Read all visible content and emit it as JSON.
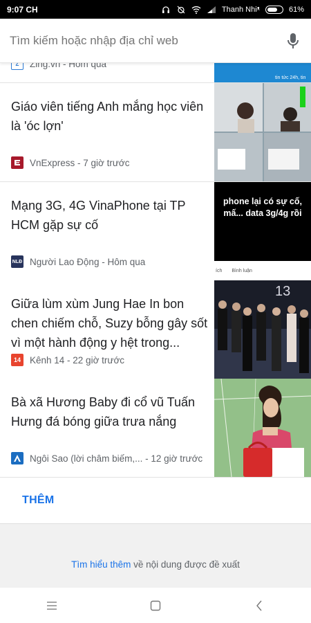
{
  "status_bar": {
    "time": "9:07 CH",
    "carrier": "Thanh Nhiᵜ",
    "battery": "61%",
    "icons": [
      "headphones-icon",
      "alarm-off-icon",
      "wifi-icon",
      "signal-icon",
      "battery-icon"
    ]
  },
  "search": {
    "placeholder": "Tìm kiếm hoặc nhập địa chỉ web",
    "icon": "mic-icon"
  },
  "feed": {
    "partial_card": {
      "source": "Zing.vn - Hôm qua",
      "thumb_text": "tin tức 24h, tin"
    },
    "cards": [
      {
        "title": "Giáo viên tiếng Anh mắng học viên là 'óc lợn'",
        "source": "VnExpress - 7 giờ trước",
        "logo_color": "#a7192b"
      },
      {
        "title": "Mạng 3G, 4G VinaPhone tại TP HCM gặp sự cố",
        "source": "Người Lao Động - Hôm qua",
        "logo_color": "#28345c",
        "logo_text": "NLĐ",
        "thumb_text": "phone lại có sự cố, mấ... data 3g/4g rồi",
        "thumb_footer": [
          "ích",
          "Bình luận"
        ]
      },
      {
        "title": "Giữa lùm xùm Jung Hae In bon chen chiếm chỗ, Suzy bỗng gây sốt vì một hành động y hệt trong...",
        "source": "Kênh 14 - 22 giờ trước",
        "logo_color": "#e8442e",
        "logo_text": "14"
      },
      {
        "title": "Bà xã Hương Baby đi cổ vũ Tuấn Hưng đá bóng giữa trưa nắng",
        "source": "Ngôi Sao (lời châm biếm,... - 12 giờ trước",
        "logo_color": "#1b6dc1"
      }
    ]
  },
  "more": {
    "label": "THÊM"
  },
  "footer": {
    "link": "Tìm hiểu thêm",
    "text": " về nội dung được đề xuất"
  },
  "colors": {
    "accent": "#1a73e8",
    "text_primary": "#202124",
    "text_secondary": "#5f6368"
  }
}
